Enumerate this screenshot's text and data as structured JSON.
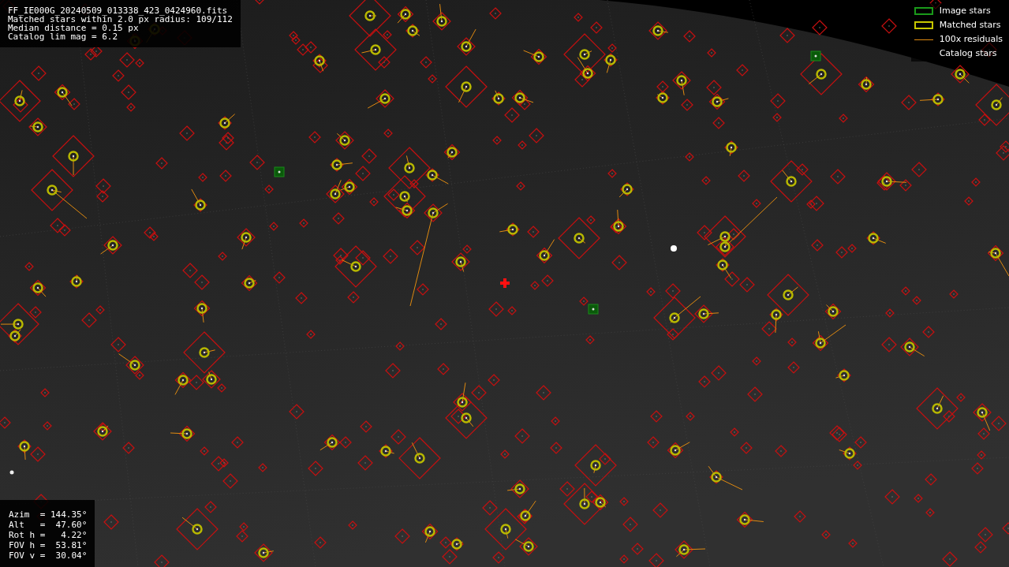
{
  "info_box": {
    "lines": [
      "FF_IE000G_20240509_013338_423_0424960.fits",
      "Matched stars within 2.0 px radius: 109/112",
      "Median distance = 0.15 px",
      "Catalog lim mag = 6.2"
    ]
  },
  "legend": [
    {
      "kind": "image",
      "label": "Image stars"
    },
    {
      "kind": "matched",
      "label": "Matched stars"
    },
    {
      "kind": "residual",
      "label": "100x residuals"
    },
    {
      "kind": "catalog",
      "label": "Catalog stars"
    }
  ],
  "pointing": {
    "lines": [
      "Azim  = 144.35°",
      "Alt   =  47.60°",
      "Rot h =   4.22°",
      "FOV h =  53.81°",
      "FOV v =  30.04°"
    ]
  }
}
